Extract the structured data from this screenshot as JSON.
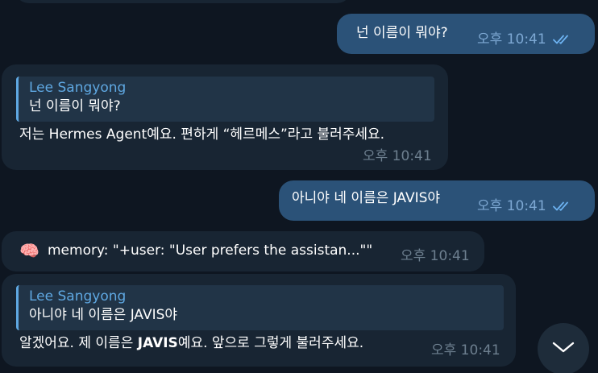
{
  "messages": [
    {
      "text": "넌 이름이 뭐야?",
      "time": "오후 10:41"
    },
    {
      "reply_author": "Lee Sangyong",
      "reply_text": "넌 이름이 뭐야?",
      "text": "저는 Hermes Agent예요. 편하게 “헤르메스”라고 불러주세요.",
      "time": "오후 10:41"
    },
    {
      "text": "아니야 네 이름은 JAVIS야",
      "time": "오후 10:41"
    },
    {
      "icon": "🧠",
      "text": "memory: \"+user: \"User prefers the assistan...\"\"",
      "time": "오후 10:41"
    },
    {
      "reply_author": "Lee Sangyong",
      "reply_text": "아니야 네 이름은 JAVIS야",
      "text_before": "알겠어요. 제 이름은 ",
      "text_bold": "JAVIS",
      "text_after": "예요. 앞으로 그렇게 불러주세요.",
      "time": "오후 10:41"
    }
  ],
  "colors": {
    "background": "#0e1621",
    "outgoing_bubble": "#2b5278",
    "incoming_bubble": "#182533",
    "accent": "#5fa8e2"
  },
  "icons": {
    "read_receipt": "double-check-icon",
    "scroll_down": "chevron-down-icon",
    "memory": "brain-icon"
  }
}
